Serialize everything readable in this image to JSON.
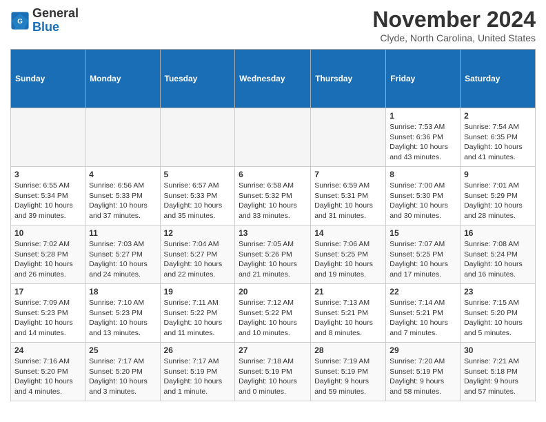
{
  "header": {
    "logo_line1": "General",
    "logo_line2": "Blue",
    "title": "November 2024",
    "location": "Clyde, North Carolina, United States"
  },
  "columns": [
    "Sunday",
    "Monday",
    "Tuesday",
    "Wednesday",
    "Thursday",
    "Friday",
    "Saturday"
  ],
  "weeks": [
    [
      {
        "day": "",
        "info": ""
      },
      {
        "day": "",
        "info": ""
      },
      {
        "day": "",
        "info": ""
      },
      {
        "day": "",
        "info": ""
      },
      {
        "day": "",
        "info": ""
      },
      {
        "day": "1",
        "info": "Sunrise: 7:53 AM\nSunset: 6:36 PM\nDaylight: 10 hours and 43 minutes."
      },
      {
        "day": "2",
        "info": "Sunrise: 7:54 AM\nSunset: 6:35 PM\nDaylight: 10 hours and 41 minutes."
      }
    ],
    [
      {
        "day": "3",
        "info": "Sunrise: 6:55 AM\nSunset: 5:34 PM\nDaylight: 10 hours and 39 minutes."
      },
      {
        "day": "4",
        "info": "Sunrise: 6:56 AM\nSunset: 5:33 PM\nDaylight: 10 hours and 37 minutes."
      },
      {
        "day": "5",
        "info": "Sunrise: 6:57 AM\nSunset: 5:33 PM\nDaylight: 10 hours and 35 minutes."
      },
      {
        "day": "6",
        "info": "Sunrise: 6:58 AM\nSunset: 5:32 PM\nDaylight: 10 hours and 33 minutes."
      },
      {
        "day": "7",
        "info": "Sunrise: 6:59 AM\nSunset: 5:31 PM\nDaylight: 10 hours and 31 minutes."
      },
      {
        "day": "8",
        "info": "Sunrise: 7:00 AM\nSunset: 5:30 PM\nDaylight: 10 hours and 30 minutes."
      },
      {
        "day": "9",
        "info": "Sunrise: 7:01 AM\nSunset: 5:29 PM\nDaylight: 10 hours and 28 minutes."
      }
    ],
    [
      {
        "day": "10",
        "info": "Sunrise: 7:02 AM\nSunset: 5:28 PM\nDaylight: 10 hours and 26 minutes."
      },
      {
        "day": "11",
        "info": "Sunrise: 7:03 AM\nSunset: 5:27 PM\nDaylight: 10 hours and 24 minutes."
      },
      {
        "day": "12",
        "info": "Sunrise: 7:04 AM\nSunset: 5:27 PM\nDaylight: 10 hours and 22 minutes."
      },
      {
        "day": "13",
        "info": "Sunrise: 7:05 AM\nSunset: 5:26 PM\nDaylight: 10 hours and 21 minutes."
      },
      {
        "day": "14",
        "info": "Sunrise: 7:06 AM\nSunset: 5:25 PM\nDaylight: 10 hours and 19 minutes."
      },
      {
        "day": "15",
        "info": "Sunrise: 7:07 AM\nSunset: 5:25 PM\nDaylight: 10 hours and 17 minutes."
      },
      {
        "day": "16",
        "info": "Sunrise: 7:08 AM\nSunset: 5:24 PM\nDaylight: 10 hours and 16 minutes."
      }
    ],
    [
      {
        "day": "17",
        "info": "Sunrise: 7:09 AM\nSunset: 5:23 PM\nDaylight: 10 hours and 14 minutes."
      },
      {
        "day": "18",
        "info": "Sunrise: 7:10 AM\nSunset: 5:23 PM\nDaylight: 10 hours and 13 minutes."
      },
      {
        "day": "19",
        "info": "Sunrise: 7:11 AM\nSunset: 5:22 PM\nDaylight: 10 hours and 11 minutes."
      },
      {
        "day": "20",
        "info": "Sunrise: 7:12 AM\nSunset: 5:22 PM\nDaylight: 10 hours and 10 minutes."
      },
      {
        "day": "21",
        "info": "Sunrise: 7:13 AM\nSunset: 5:21 PM\nDaylight: 10 hours and 8 minutes."
      },
      {
        "day": "22",
        "info": "Sunrise: 7:14 AM\nSunset: 5:21 PM\nDaylight: 10 hours and 7 minutes."
      },
      {
        "day": "23",
        "info": "Sunrise: 7:15 AM\nSunset: 5:20 PM\nDaylight: 10 hours and 5 minutes."
      }
    ],
    [
      {
        "day": "24",
        "info": "Sunrise: 7:16 AM\nSunset: 5:20 PM\nDaylight: 10 hours and 4 minutes."
      },
      {
        "day": "25",
        "info": "Sunrise: 7:17 AM\nSunset: 5:20 PM\nDaylight: 10 hours and 3 minutes."
      },
      {
        "day": "26",
        "info": "Sunrise: 7:17 AM\nSunset: 5:19 PM\nDaylight: 10 hours and 1 minute."
      },
      {
        "day": "27",
        "info": "Sunrise: 7:18 AM\nSunset: 5:19 PM\nDaylight: 10 hours and 0 minutes."
      },
      {
        "day": "28",
        "info": "Sunrise: 7:19 AM\nSunset: 5:19 PM\nDaylight: 9 hours and 59 minutes."
      },
      {
        "day": "29",
        "info": "Sunrise: 7:20 AM\nSunset: 5:19 PM\nDaylight: 9 hours and 58 minutes."
      },
      {
        "day": "30",
        "info": "Sunrise: 7:21 AM\nSunset: 5:18 PM\nDaylight: 9 hours and 57 minutes."
      }
    ]
  ]
}
